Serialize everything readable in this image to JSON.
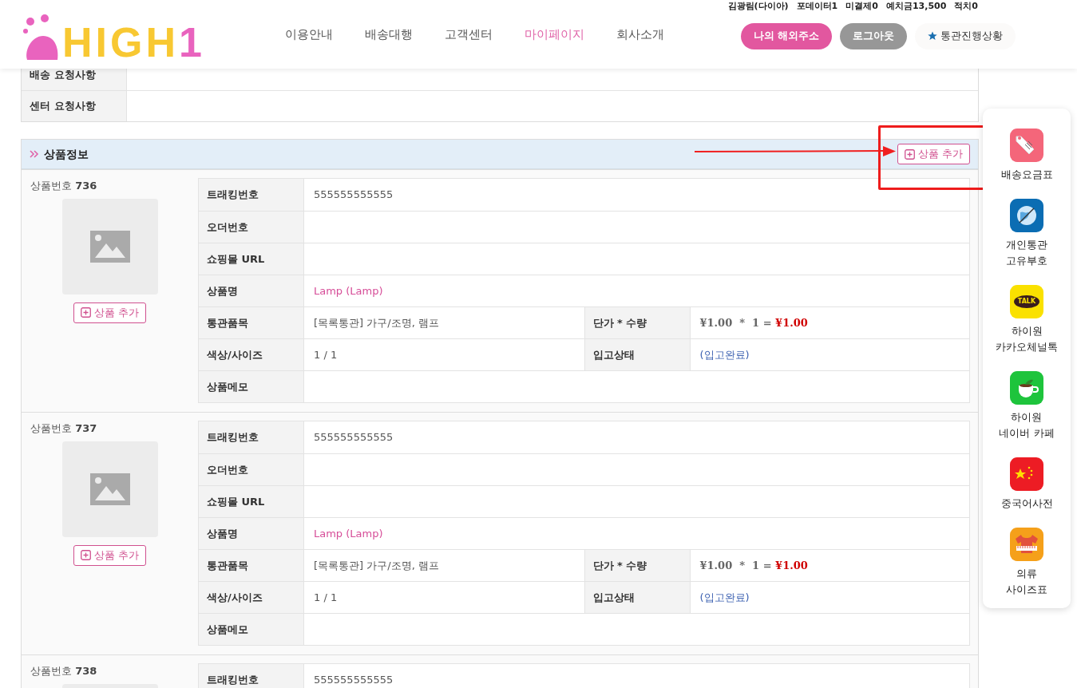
{
  "header": {
    "logo": {
      "text": "HIGH",
      "suffix": "1"
    },
    "user_status": [
      "김광림(다이아)",
      "포데이터1",
      "미결제0",
      "예치금13,500",
      "적치0"
    ],
    "nav": [
      {
        "label": "이용안내",
        "selected": false
      },
      {
        "label": "배송대행",
        "selected": false
      },
      {
        "label": "고객센터",
        "selected": false
      },
      {
        "label": "마이페이지",
        "selected": true
      },
      {
        "label": "회사소개",
        "selected": false
      }
    ],
    "buttons": [
      {
        "kind": "primary",
        "label": "나의 해외주소"
      },
      {
        "kind": "secondary",
        "label": "로그아웃"
      },
      {
        "kind": "star",
        "label": "통관진행상황"
      }
    ]
  },
  "requests": [
    {
      "label": "배송 요청사항"
    },
    {
      "label": "센터 요청사항"
    }
  ],
  "section": {
    "title": "상품정보",
    "add_button": "상품 추가",
    "products": [
      {
        "number_label": "상품번호",
        "number": "736",
        "add_button": "상품 추가",
        "rows": [
          {
            "cells": [
              {
                "label": "트래킹번호",
                "kind": "plain",
                "value": "555555555555"
              }
            ]
          },
          {
            "cells": [
              {
                "label": "오더번호",
                "kind": "plain"
              }
            ]
          },
          {
            "cells": [
              {
                "label": "쇼핑몰 URL",
                "kind": "plain"
              }
            ]
          },
          {
            "cells": [
              {
                "label": "상품명",
                "kind": "name",
                "value": "Lamp (Lamp)"
              }
            ]
          },
          {
            "cells": [
              {
                "label": "통관품목",
                "kind": "plain",
                "value": "[목록통관] 가구/조명, 램프"
              },
              {
                "label": "단가 * 수량",
                "kind": "price",
                "value": "¥1.00  *  1 =",
                "total": "¥1.00"
              }
            ]
          },
          {
            "cells": [
              {
                "label": "색상/사이즈",
                "kind": "plain",
                "value": "1 / 1"
              },
              {
                "label": "입고상태",
                "kind": "status",
                "value": "(입고완료)"
              }
            ]
          },
          {
            "cells": [
              {
                "label": "상품메모",
                "kind": "plain"
              }
            ]
          }
        ]
      },
      {
        "number_label": "상품번호",
        "number": "737",
        "add_button": "상품 추가",
        "rows": [
          {
            "cells": [
              {
                "label": "트래킹번호",
                "kind": "plain",
                "value": "555555555555"
              }
            ]
          },
          {
            "cells": [
              {
                "label": "오더번호",
                "kind": "plain"
              }
            ]
          },
          {
            "cells": [
              {
                "label": "쇼핑몰 URL",
                "kind": "plain"
              }
            ]
          },
          {
            "cells": [
              {
                "label": "상품명",
                "kind": "name",
                "value": "Lamp (Lamp)"
              }
            ]
          },
          {
            "cells": [
              {
                "label": "통관품목",
                "kind": "plain",
                "value": "[목록통관] 가구/조명, 램프"
              },
              {
                "label": "단가 * 수량",
                "kind": "price",
                "value": "¥1.00  *  1 =",
                "total": "¥1.00"
              }
            ]
          },
          {
            "cells": [
              {
                "label": "색상/사이즈",
                "kind": "plain",
                "value": "1 / 1"
              },
              {
                "label": "입고상태",
                "kind": "status",
                "value": "(입고완료)"
              }
            ]
          },
          {
            "cells": [
              {
                "label": "상품메모",
                "kind": "plain"
              }
            ]
          }
        ]
      },
      {
        "number_label": "상품번호",
        "number": "738",
        "rows": [
          {
            "cells": [
              {
                "label": "트래킹번호",
                "kind": "plain",
                "value": "555555555555"
              }
            ]
          }
        ]
      }
    ]
  },
  "quick_menu": [
    {
      "kind": "tag",
      "lines": [
        "배송요금표"
      ]
    },
    {
      "kind": "globe",
      "lines": [
        "개인통관",
        "고유부호"
      ]
    },
    {
      "kind": "talk",
      "badge_text": "TALK",
      "lines": [
        "하이원",
        "카카오체널톡"
      ]
    },
    {
      "kind": "cafe",
      "lines": [
        "하이원",
        "네이버 카페"
      ]
    },
    {
      "kind": "china",
      "lines": [
        "중국어사전"
      ]
    },
    {
      "kind": "shirt",
      "lines": [
        "의류",
        "사이즈표"
      ]
    }
  ]
}
